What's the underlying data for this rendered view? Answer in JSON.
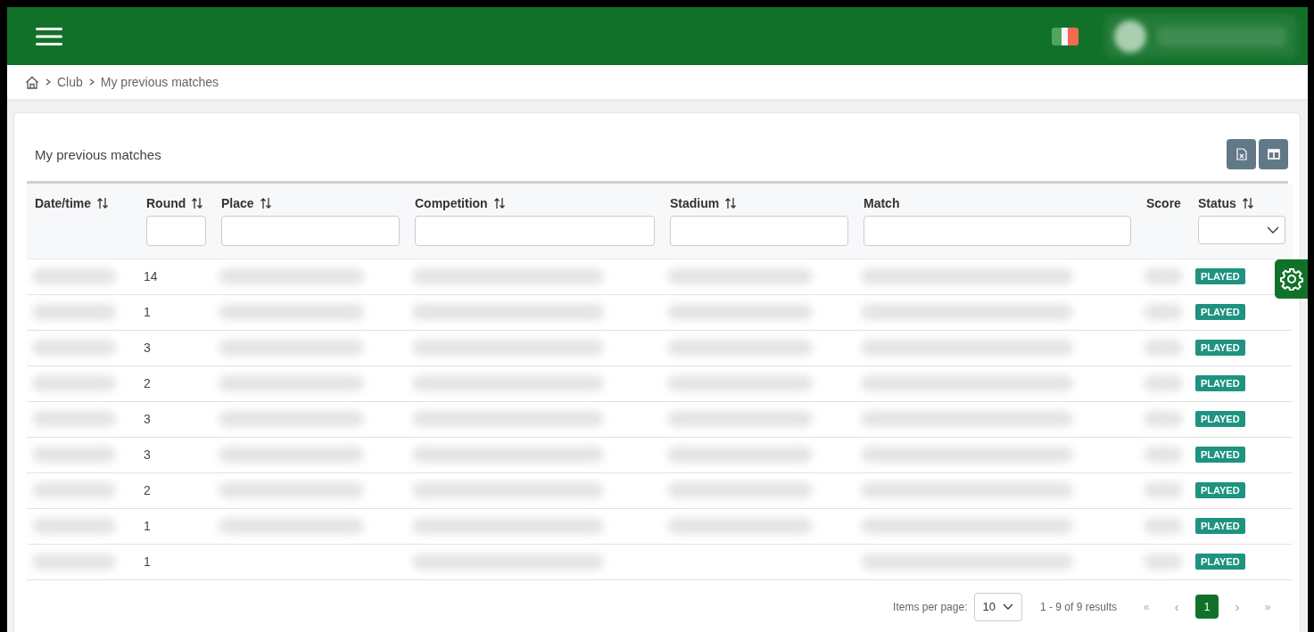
{
  "header": {
    "user_menu": {
      "blurred": true
    }
  },
  "breadcrumb": [
    "Club",
    "My previous matches"
  ],
  "card": {
    "title": "My previous matches"
  },
  "table": {
    "columns": [
      {
        "label": "Date/time",
        "sortable": true
      },
      {
        "label": "Round",
        "sortable": true,
        "filter": {
          "kind": "text"
        }
      },
      {
        "label": "Place",
        "sortable": true,
        "filter": {
          "kind": "text"
        }
      },
      {
        "label": "Competition",
        "sortable": true,
        "filter": {
          "kind": "text"
        }
      },
      {
        "label": "Stadium",
        "sortable": true,
        "filter": {
          "kind": "text"
        }
      },
      {
        "label": "Match",
        "sortable": false,
        "filter": {
          "kind": "text"
        }
      },
      {
        "label": "Score",
        "sortable": false
      },
      {
        "label": "Status",
        "sortable": true,
        "filter": {
          "kind": "select"
        }
      }
    ],
    "rows": [
      {
        "cells": [
          {
            "kind": "blurred"
          },
          {
            "kind": "text",
            "text": "14"
          },
          {
            "kind": "blurred"
          },
          {
            "kind": "blurred"
          },
          {
            "kind": "blurred"
          },
          {
            "kind": "blurred"
          },
          {
            "kind": "blurred"
          },
          {
            "kind": "status",
            "text": "PLAYED"
          }
        ]
      },
      {
        "cells": [
          {
            "kind": "blurred"
          },
          {
            "kind": "text",
            "text": "1"
          },
          {
            "kind": "blurred"
          },
          {
            "kind": "blurred"
          },
          {
            "kind": "blurred"
          },
          {
            "kind": "blurred"
          },
          {
            "kind": "blurred"
          },
          {
            "kind": "status",
            "text": "PLAYED"
          }
        ]
      },
      {
        "cells": [
          {
            "kind": "blurred"
          },
          {
            "kind": "text",
            "text": "3"
          },
          {
            "kind": "blurred"
          },
          {
            "kind": "blurred"
          },
          {
            "kind": "blurred"
          },
          {
            "kind": "blurred"
          },
          {
            "kind": "blurred"
          },
          {
            "kind": "status",
            "text": "PLAYED"
          }
        ]
      },
      {
        "cells": [
          {
            "kind": "blurred"
          },
          {
            "kind": "text",
            "text": "2"
          },
          {
            "kind": "blurred"
          },
          {
            "kind": "blurred"
          },
          {
            "kind": "blurred"
          },
          {
            "kind": "blurred"
          },
          {
            "kind": "blurred"
          },
          {
            "kind": "status",
            "text": "PLAYED"
          }
        ]
      },
      {
        "cells": [
          {
            "kind": "blurred"
          },
          {
            "kind": "text",
            "text": "3"
          },
          {
            "kind": "blurred"
          },
          {
            "kind": "blurred"
          },
          {
            "kind": "blurred"
          },
          {
            "kind": "blurred"
          },
          {
            "kind": "blurred"
          },
          {
            "kind": "status",
            "text": "PLAYED"
          }
        ]
      },
      {
        "cells": [
          {
            "kind": "blurred"
          },
          {
            "kind": "text",
            "text": "3"
          },
          {
            "kind": "blurred"
          },
          {
            "kind": "blurred"
          },
          {
            "kind": "blurred"
          },
          {
            "kind": "blurred"
          },
          {
            "kind": "blurred"
          },
          {
            "kind": "status",
            "text": "PLAYED"
          }
        ]
      },
      {
        "cells": [
          {
            "kind": "blurred"
          },
          {
            "kind": "text",
            "text": "2"
          },
          {
            "kind": "blurred"
          },
          {
            "kind": "blurred"
          },
          {
            "kind": "blurred"
          },
          {
            "kind": "blurred"
          },
          {
            "kind": "blurred"
          },
          {
            "kind": "status",
            "text": "PLAYED"
          }
        ]
      },
      {
        "cells": [
          {
            "kind": "blurred"
          },
          {
            "kind": "text",
            "text": "1"
          },
          {
            "kind": "blurred"
          },
          {
            "kind": "blurred"
          },
          {
            "kind": "blurred"
          },
          {
            "kind": "blurred"
          },
          {
            "kind": "blurred"
          },
          {
            "kind": "status",
            "text": "PLAYED"
          }
        ]
      },
      {
        "cells": [
          {
            "kind": "blurred"
          },
          {
            "kind": "text",
            "text": "1"
          },
          {
            "kind": "empty"
          },
          {
            "kind": "blurred"
          },
          {
            "kind": "empty"
          },
          {
            "kind": "blurred"
          },
          {
            "kind": "blurred"
          },
          {
            "kind": "status",
            "text": "PLAYED"
          }
        ]
      }
    ]
  },
  "pagination": {
    "items_per_page_label": "Items per page:",
    "items_per_page": "10",
    "summary": "1 - 9 of 9 results",
    "first": "«",
    "prev": "‹",
    "pages": [
      {
        "label": "1",
        "selected": true
      }
    ],
    "next": "›",
    "last": "»"
  }
}
